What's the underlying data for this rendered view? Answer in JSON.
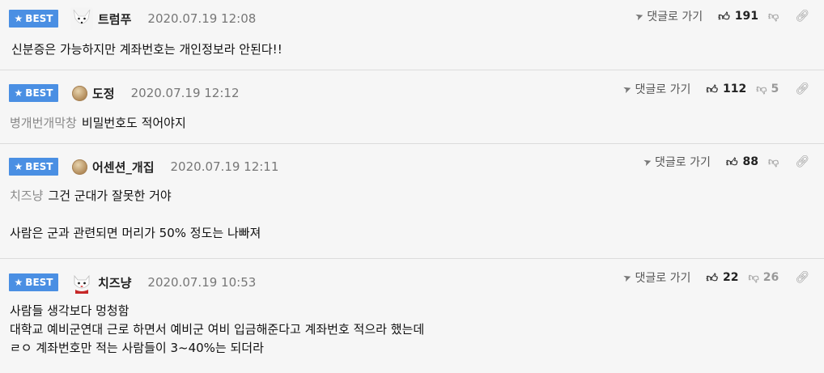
{
  "badge_label": "BEST",
  "reply_label": "댓글로 가기",
  "comments": [
    {
      "nick": "트럼푸",
      "avatar": "fox-avatar",
      "date": "2020.07.19 12:08",
      "up": "191",
      "down": "",
      "mention": "",
      "lines": [
        "신분증은 가능하지만 계좌번호는 개인정보라 안된다!!"
      ]
    },
    {
      "nick": "도정",
      "avatar": "default-avatar",
      "date": "2020.07.19 12:12",
      "up": "112",
      "down": "5",
      "mention": "병개번개막창",
      "lines": [
        "비밀번호도 적어야지"
      ]
    },
    {
      "nick": "어센션_개집",
      "avatar": "default-avatar",
      "date": "2020.07.19 12:11",
      "up": "88",
      "down": "",
      "mention": "치즈냥",
      "lines": [
        "그건 군대가 잘못한 거야",
        "",
        "사람은 군과 관련되면 머리가 50% 정도는 나빠져"
      ]
    },
    {
      "nick": "치즈냥",
      "avatar": "cat-avatar",
      "date": "2020.07.19 10:53",
      "up": "22",
      "down": "26",
      "mention": "",
      "lines": [
        "사람들 생각보다 멍청함",
        "대학교 예비군연대 근로 하면서 예비군 여비 입금해준다고 계좌번호 적으라 했는데",
        "ㄹㅇ 계좌번호만 적는 사람들이 3~40%는 되더라"
      ]
    }
  ],
  "colors": {
    "badge": "#4a8fe3",
    "background": "#f6f6f6",
    "date": "#777777",
    "mention": "#888888"
  },
  "icons": {
    "badge": "star-icon",
    "reply": "arrow-icon",
    "up": "thumbs-up-icon",
    "down": "thumbs-down-icon",
    "link": "link-icon"
  }
}
